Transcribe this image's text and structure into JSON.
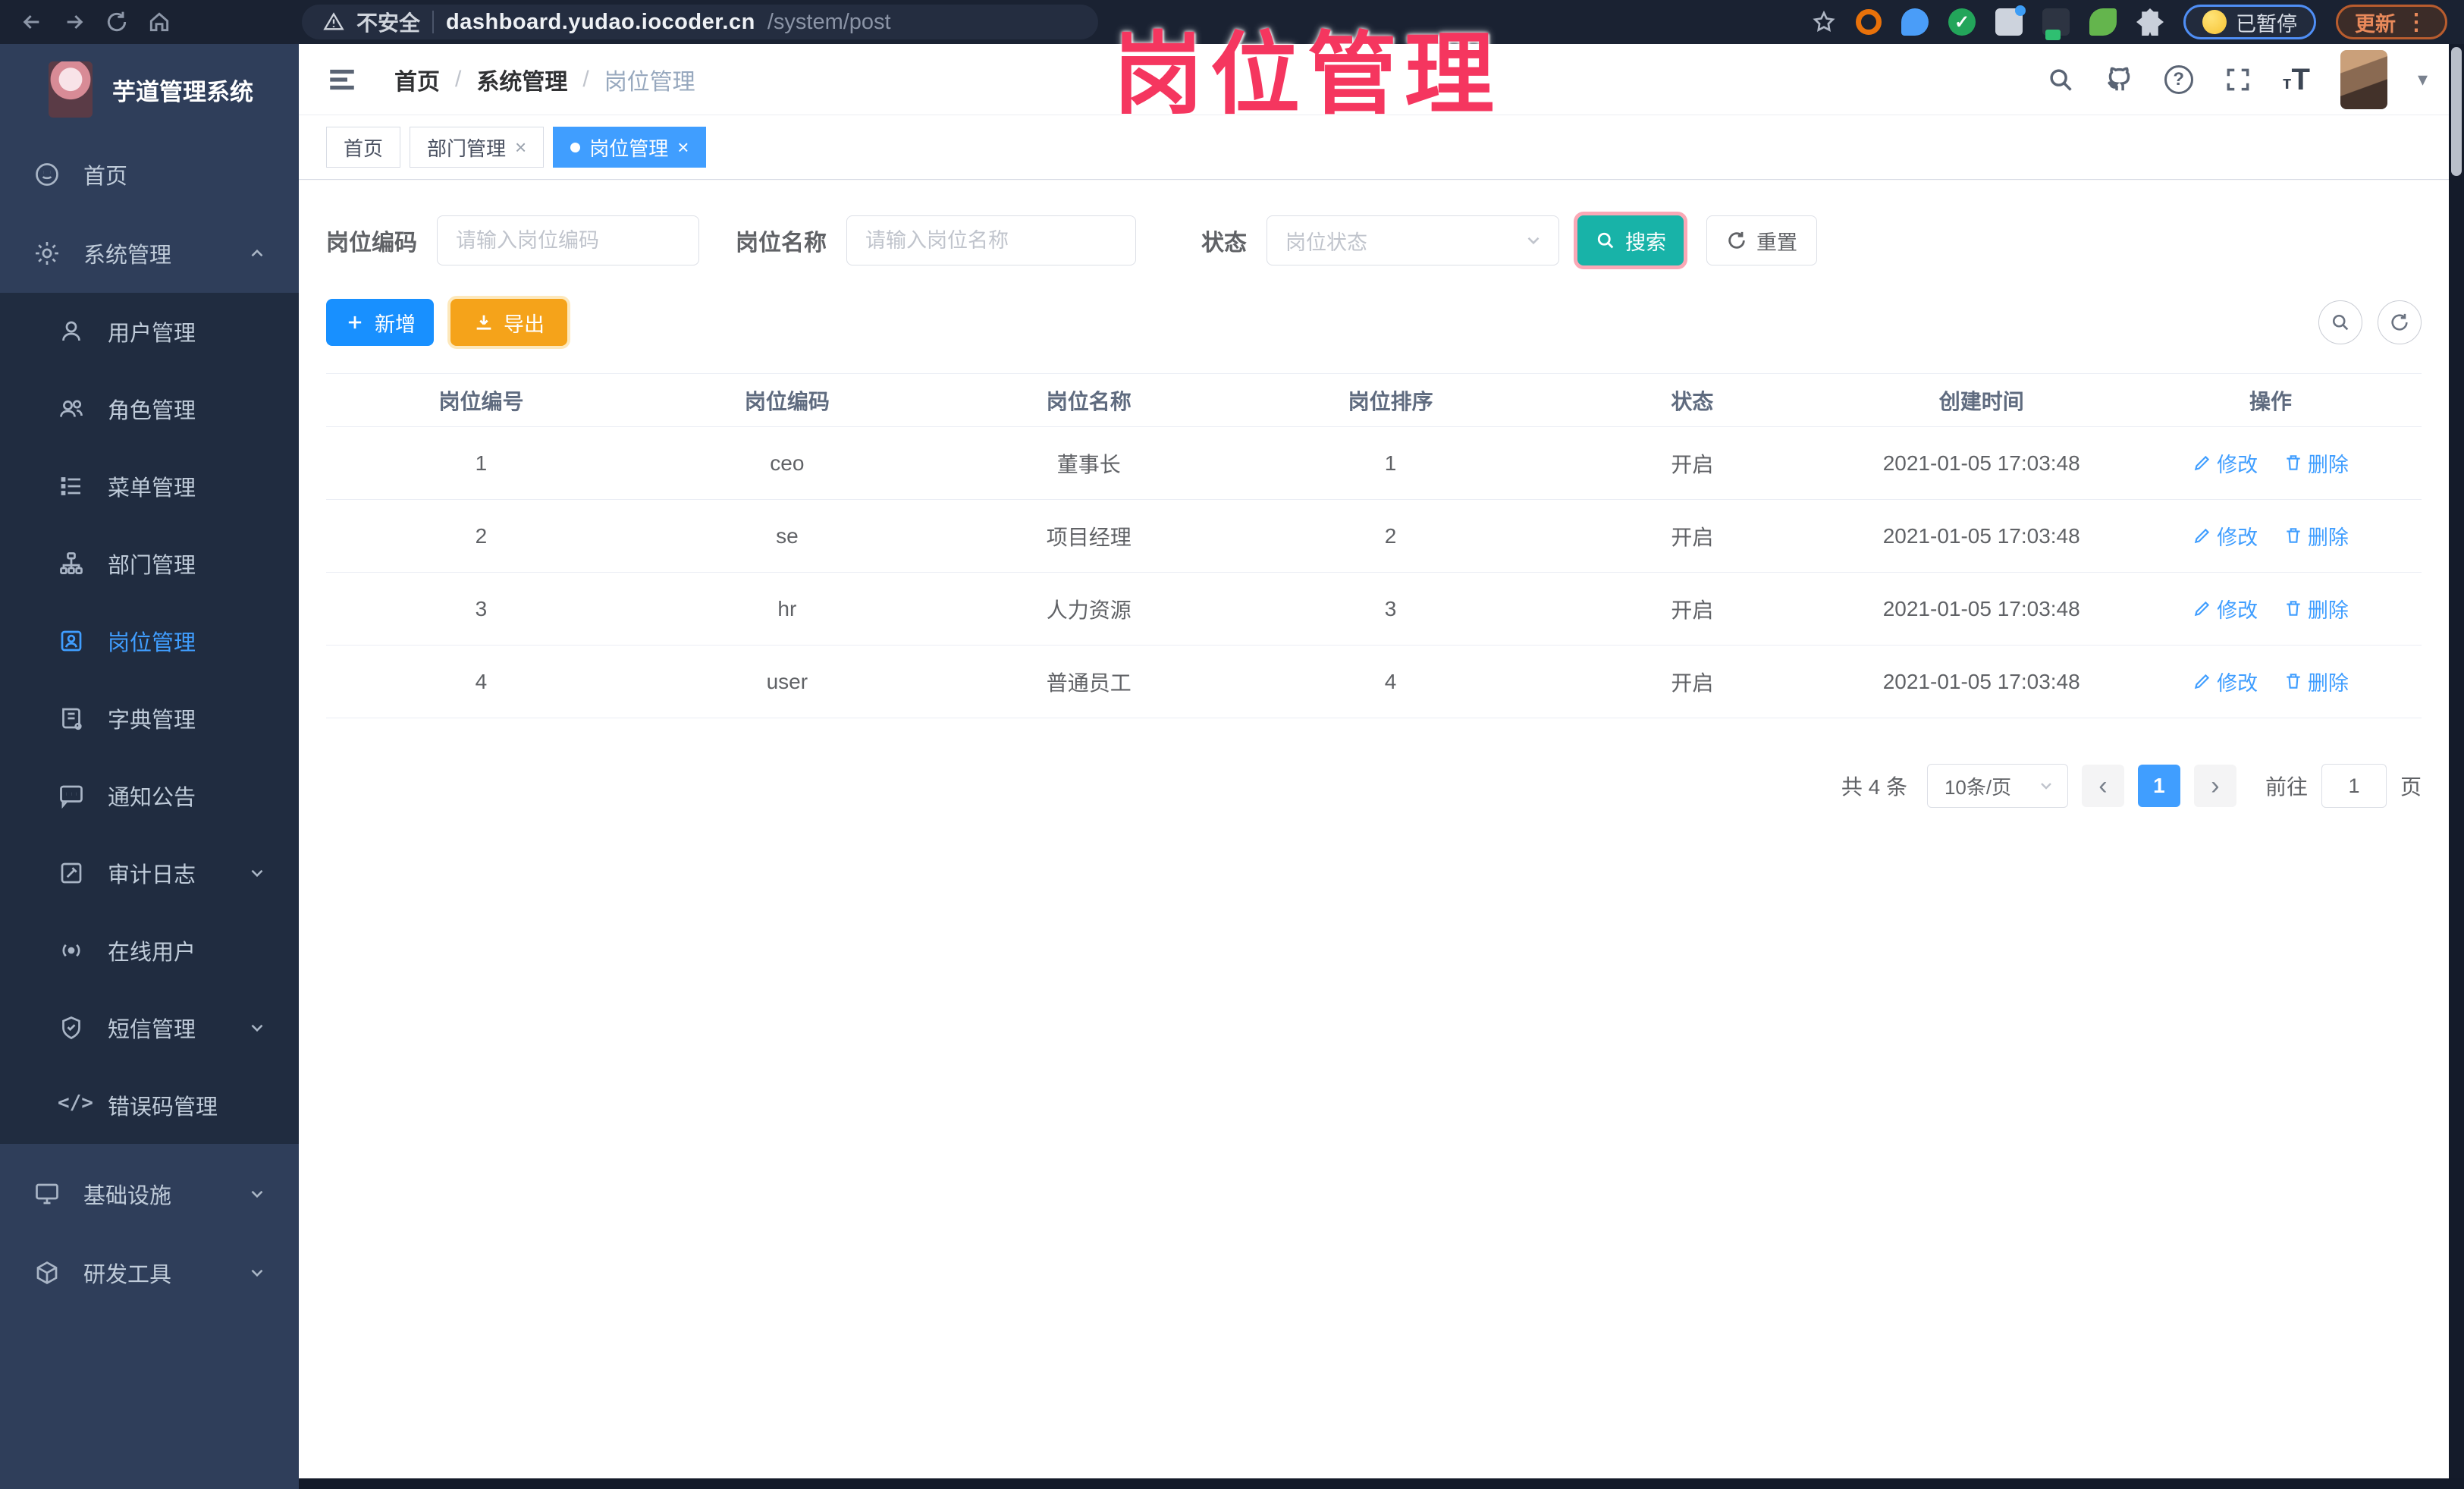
{
  "browser": {
    "security_label": "不安全",
    "url_host": "dashboard.yudao.iocoder.cn",
    "url_path": "/system/post",
    "paused_badge": "已暂停",
    "update_button": "更新",
    "kebab": "⋮"
  },
  "watermark": "岗位管理",
  "sidebar": {
    "app_title": "芋道管理系统",
    "items": [
      "首页",
      "系统管理",
      "用户管理",
      "角色管理",
      "菜单管理",
      "部门管理",
      "岗位管理",
      "字典管理",
      "通知公告",
      "审计日志",
      "在线用户",
      "短信管理",
      "错误码管理",
      "基础设施",
      "研发工具"
    ]
  },
  "breadcrumb": {
    "home": "首页",
    "section": "系统管理",
    "current": "岗位管理"
  },
  "tabs": [
    "首页",
    "部门管理",
    "岗位管理"
  ],
  "filters": {
    "post_code_label": "岗位编码",
    "post_code_placeholder": "请输入岗位编码",
    "post_name_label": "岗位名称",
    "post_name_placeholder": "请输入岗位名称",
    "status_label": "状态",
    "status_placeholder": "岗位状态",
    "search_button": "搜索",
    "reset_button": "重置"
  },
  "toolbar": {
    "add_button": "新增",
    "export_button": "导出"
  },
  "table": {
    "columns": [
      "岗位编号",
      "岗位编码",
      "岗位名称",
      "岗位排序",
      "状态",
      "创建时间",
      "操作"
    ],
    "edit_label": "修改",
    "delete_label": "删除",
    "rows": [
      {
        "id": "1",
        "code": "ceo",
        "name": "董事长",
        "sort": "1",
        "status": "开启",
        "time": "2021-01-05 17:03:48"
      },
      {
        "id": "2",
        "code": "se",
        "name": "项目经理",
        "sort": "2",
        "status": "开启",
        "time": "2021-01-05 17:03:48"
      },
      {
        "id": "3",
        "code": "hr",
        "name": "人力资源",
        "sort": "3",
        "status": "开启",
        "time": "2021-01-05 17:03:48"
      },
      {
        "id": "4",
        "code": "user",
        "name": "普通员工",
        "sort": "4",
        "status": "开启",
        "time": "2021-01-05 17:03:48"
      }
    ]
  },
  "pagination": {
    "total_text": "共 4 条",
    "page_size": "10条/页",
    "prev": "‹",
    "current_page": "1",
    "next": "›",
    "goto_label": "前往",
    "goto_value": "1",
    "page_unit": "页"
  },
  "colors": {
    "accent_blue": "#409eff",
    "add_button_blue": "#1890ff",
    "export_orange": "#f5a31a",
    "search_teal": "#18b3a8",
    "watermark_pink": "#f5365f",
    "sidebar_bg": "#2f3e5a",
    "submenu_bg": "#202c40",
    "browser_bar_bg": "#1a2232",
    "tab_active_bg": "#409eff"
  }
}
